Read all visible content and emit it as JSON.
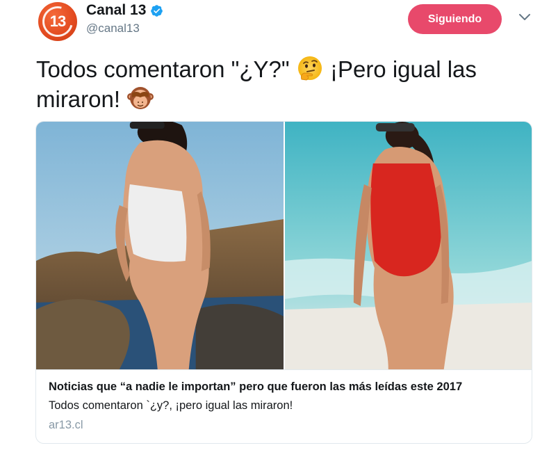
{
  "account": {
    "display_name": "Canal 13",
    "handle": "@canal13",
    "avatar_text": "13",
    "verified": true,
    "brand_color": "#e24a1f"
  },
  "actions": {
    "follow_label": "Siguiendo",
    "follow_color": "#e8496b",
    "menu_icon": "chevron-down-icon"
  },
  "tweet": {
    "text_part1": "Todos comentaron \"¿Y?\"",
    "text_part2": "¡Pero igual las",
    "text_part3": "miraron!",
    "emoji1": "thinking-face",
    "emoji2": "see-no-evil-monkey"
  },
  "card": {
    "title": "Noticias que “a nadie le importan” pero que fueron las más leídas este 2017",
    "description": "Todos comentaron `¿y?, ¡pero igual las miraron!",
    "domain": "ar13.cl",
    "images": [
      "woman-white-swimsuit-rocks",
      "woman-red-swimsuit-beach"
    ]
  }
}
